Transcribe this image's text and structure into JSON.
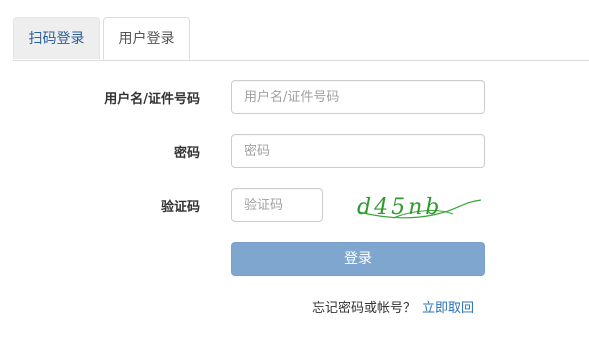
{
  "tabs": [
    {
      "label": "扫码登录",
      "active": false
    },
    {
      "label": "用户登录",
      "active": true
    }
  ],
  "form": {
    "username": {
      "label": "用户名/证件号码",
      "placeholder": "用户名/证件号码",
      "value": ""
    },
    "password": {
      "label": "密码",
      "placeholder": "密码",
      "value": ""
    },
    "captcha": {
      "label": "验证码",
      "placeholder": "验证码",
      "value": "",
      "image_text": "d45nb"
    },
    "login_label": "登录",
    "forgot_text": "忘记密码或帐号？",
    "reset_link": "立即取回"
  },
  "colors": {
    "accent": "#2a70b8",
    "login_button": "#7ea6cf",
    "captcha_text": "#2e9a2e"
  }
}
